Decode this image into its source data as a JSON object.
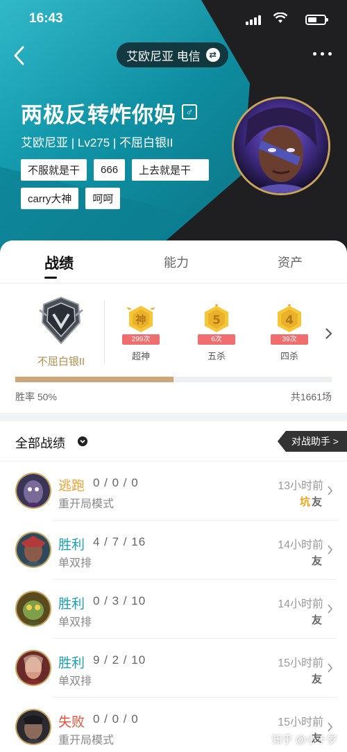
{
  "status_bar": {
    "time": "16:43"
  },
  "header": {
    "server_label": "艾欧尼亚 电信",
    "player_name": "两极反转炸你妈",
    "subtitle": "艾欧尼亚 | Lv275 | 不屈白银II",
    "gender_symbol": "♂",
    "tags": [
      "不服就是干",
      "666",
      "上去就是干",
      "carry大神",
      "呵呵"
    ]
  },
  "tabs": [
    {
      "label": "战绩",
      "active": true
    },
    {
      "label": "能力",
      "active": false
    },
    {
      "label": "资产",
      "active": false
    }
  ],
  "rank": {
    "label": "不屈白银II"
  },
  "medals": [
    {
      "glyph": "神",
      "count": "299次",
      "name": "超神"
    },
    {
      "glyph": "5",
      "count": "6次",
      "name": "五杀"
    },
    {
      "glyph": "4",
      "count": "39次",
      "name": "四杀"
    }
  ],
  "stats": {
    "win_rate_label": "胜率 50%",
    "win_rate": 0.5,
    "total_label": "共1661场"
  },
  "matches_header": {
    "title": "全部战绩",
    "assist_button": "对战助手 >"
  },
  "matches": [
    {
      "result": "逃跑",
      "result_color": "#f0a030",
      "kda": "0 / 0 / 0",
      "mode": "重开局模式",
      "ago": "13小时前",
      "badges": [
        "坑",
        "友"
      ]
    },
    {
      "result": "胜利",
      "result_color": "#1a9fb3",
      "kda": "4 / 7 / 16",
      "mode": "单双排",
      "ago": "14小时前",
      "badges": [
        "友"
      ]
    },
    {
      "result": "胜利",
      "result_color": "#1a9fb3",
      "kda": "0 / 3 / 10",
      "mode": "单双排",
      "ago": "14小时前",
      "badges": [
        "友"
      ]
    },
    {
      "result": "胜利",
      "result_color": "#1a9fb3",
      "kda": "9 / 2 / 10",
      "mode": "单双排",
      "ago": "15小时前",
      "badges": [
        "友"
      ]
    },
    {
      "result": "失败",
      "result_color": "#e8503a",
      "kda": "0 / 0 / 0",
      "mode": "重开局模式",
      "ago": "15小时前",
      "badges": [
        "友"
      ]
    }
  ],
  "watermark": "知乎 @小十岁",
  "colors": {
    "accent_gold": "#c9a45b",
    "teal": "#1fb2c4",
    "win": "#1a9fb3",
    "lose": "#e8503a",
    "escape": "#f0a030"
  }
}
